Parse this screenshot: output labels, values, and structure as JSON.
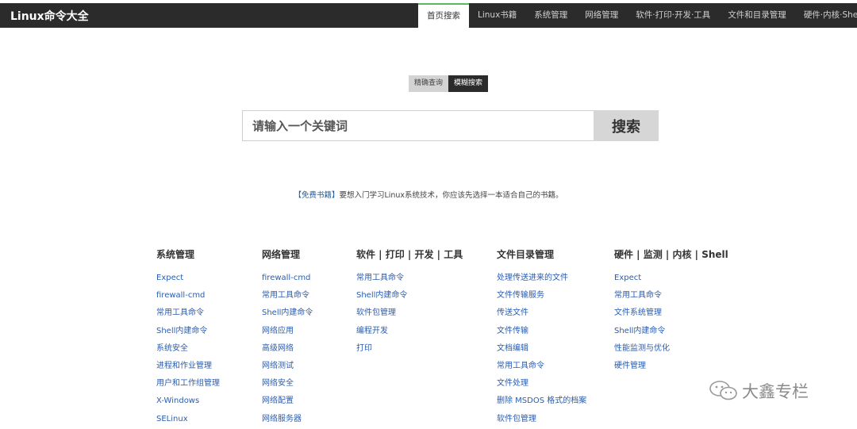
{
  "header": {
    "logo": "Linux命令大全",
    "nav": [
      {
        "label": "首页搜索",
        "active": true
      },
      {
        "label": "Linux书籍",
        "active": false
      },
      {
        "label": "系统管理",
        "active": false
      },
      {
        "label": "网络管理",
        "active": false
      },
      {
        "label": "软件·打印·开发·工具",
        "active": false
      },
      {
        "label": "文件和目录管理",
        "active": false
      },
      {
        "label": "硬件·内核·Shell",
        "active": false
      }
    ]
  },
  "search": {
    "modes": [
      {
        "label": "精确查询",
        "active": false
      },
      {
        "label": "模糊搜索",
        "active": true
      }
    ],
    "placeholder": "请输入一个关键词",
    "button_label": "搜索"
  },
  "notice": {
    "link": "【免费书籍】",
    "text": "要想入门学习Linux系统技术，你应该先选择一本适合自己的书籍。"
  },
  "categories": [
    {
      "title": "系统管理",
      "items": [
        "Expect",
        "firewall-cmd",
        "常用工具命令",
        "Shell内建命令",
        "系统安全",
        "进程和作业管理",
        "用户和工作组管理",
        "X-Windows",
        "SELinux"
      ]
    },
    {
      "title": "网络管理",
      "items": [
        "firewall-cmd",
        "常用工具命令",
        "Shell内建命令",
        "网络应用",
        "高级网络",
        "网络测试",
        "网络安全",
        "网络配置",
        "网络服务器"
      ]
    },
    {
      "title": "软件 | 打印 | 开发 | 工具",
      "items": [
        "常用工具命令",
        "Shell内建命令",
        "软件包管理",
        "编程开发",
        "打印"
      ]
    },
    {
      "title": "文件目录管理",
      "items": [
        "处理传送进来的文件",
        "文件传输服务",
        "传送文件",
        "文件传输",
        "文档编辑",
        "常用工具命令",
        "文件处理",
        "删除 MSDOS 格式的档案",
        "软件包管理"
      ]
    },
    {
      "title": "硬件 | 监测 | 内核 | Shell",
      "items": [
        "Expect",
        "常用工具命令",
        "文件系统管理",
        "Shell内建命令",
        "性能监测与优化",
        "硬件管理"
      ]
    }
  ],
  "watermark": {
    "icon": "wechat-icon",
    "text": "大鑫专栏"
  }
}
